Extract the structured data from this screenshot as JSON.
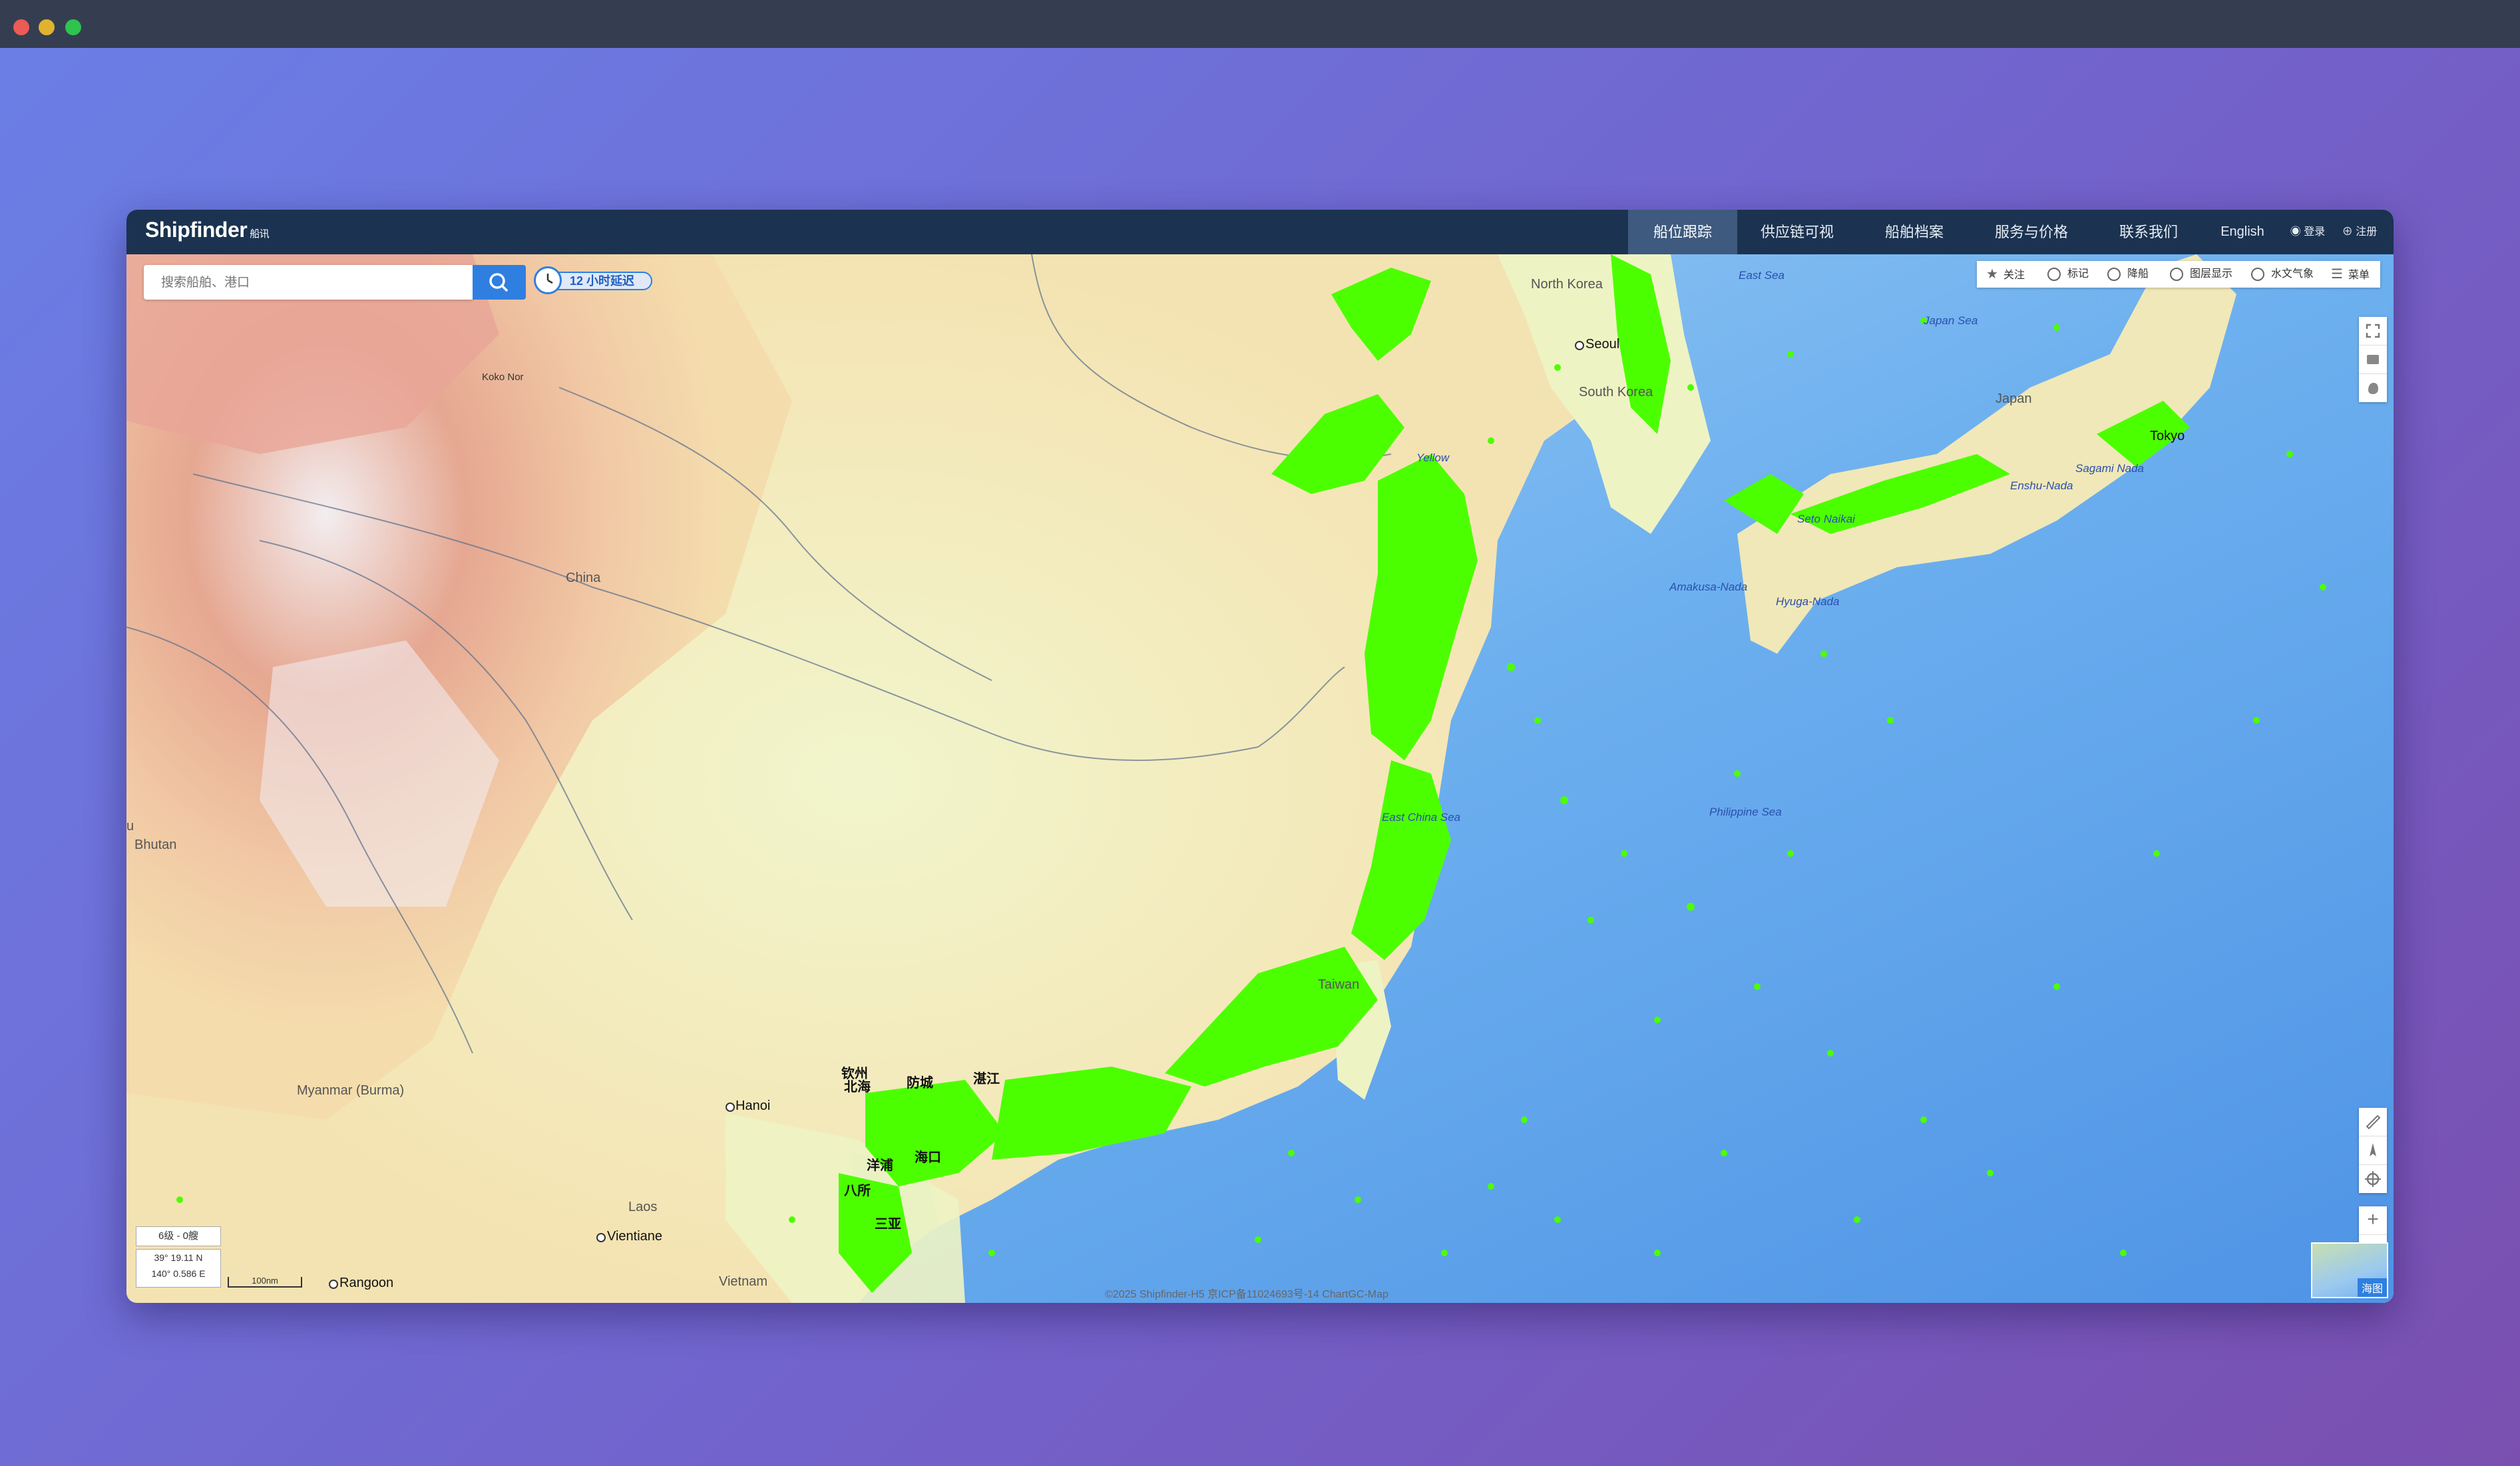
{
  "window": {
    "controls": [
      "close",
      "minimize",
      "maximize"
    ]
  },
  "brand": {
    "name": "Shipfinder",
    "sub": "船讯"
  },
  "nav": {
    "items": [
      {
        "label": "船位跟踪",
        "active": true
      },
      {
        "label": "供应链可视"
      },
      {
        "label": "船舶档案"
      },
      {
        "label": "服务与价格"
      },
      {
        "label": "联系我们"
      },
      {
        "label": "English"
      }
    ],
    "login": "登录",
    "register": "注册"
  },
  "search": {
    "placeholder": "搜索船舶、港口",
    "button_icon": "search-icon"
  },
  "delay": {
    "label": "12 小时延迟",
    "icon": "clock-icon"
  },
  "toolbar": {
    "items": [
      {
        "label": "关注",
        "icon": "star-icon"
      },
      {
        "label": "标记",
        "icon": "tag-icon"
      },
      {
        "label": "降船",
        "icon": "typhoon-icon"
      },
      {
        "label": "图层显示",
        "icon": "layers-icon"
      },
      {
        "label": "水文气象",
        "icon": "weather-icon"
      },
      {
        "label": "菜单",
        "icon": "menu-icon"
      }
    ]
  },
  "map_controls": {
    "top": [
      "fullscreen-icon",
      "ship-icon",
      "hand-icon"
    ],
    "bottom": [
      "ruler-icon",
      "compass-icon",
      "locate-icon"
    ],
    "zoom_in": "+",
    "zoom_out": "−"
  },
  "map": {
    "colors": {
      "land_low": "#eef4c7",
      "land_mid": "#f4d9a8",
      "land_high": "#e7a38e",
      "snow": "#f2eef4",
      "sea_shallow": "#cfe6f7",
      "sea": "#6db0ef",
      "sea_deep": "#4f94e6",
      "ships": "#4cff00"
    },
    "labels": {
      "north_korea": "North Korea",
      "seoul": "Seoul",
      "south_korea": "South Korea",
      "japan": "Japan",
      "tokyo": "Tokyo",
      "china": "China",
      "koko_nor": "Koko Nor",
      "bhutan": "Bhutan",
      "myanmar": "Myanmar (Burma)",
      "laos": "Laos",
      "vietnam": "Vietnam",
      "taiwan": "Taiwan",
      "hanoi": "Hanoi",
      "vientiane": "Vientiane",
      "rangoon": "Rangoon",
      "u": "u",
      "qinzhou": "钦州",
      "beihai": "北海",
      "zhanjiang": "湛江",
      "yangpu": "洋浦",
      "haikou": "海口",
      "basuo": "八所",
      "sanya": "三亚",
      "fangcheng": "防城"
    },
    "sea_labels": {
      "east_sea": "East Sea",
      "japan_sea": "Japan Sea",
      "yellow_sea": "Yellow",
      "east_china_sea": "East China Sea",
      "philippine_sea": "Philippine Sea",
      "amakusa_nada": "Amakusa-Nada",
      "hyuga_nada": "Hyuga-Nada",
      "enshu_nada": "Enshu-Nada",
      "sagami_nada": "Sagami Nada",
      "seto": "Seto Naikai"
    }
  },
  "status": {
    "zoom": "6级 - 0艘",
    "lat": "39° 19.11 N",
    "lon": "140° 0.586 E",
    "scale": "100nm",
    "copyright": "©2025 Shipfinder-H5  京ICP备11024693号-14  ChartGC-Map",
    "minimap_label": "海图"
  }
}
